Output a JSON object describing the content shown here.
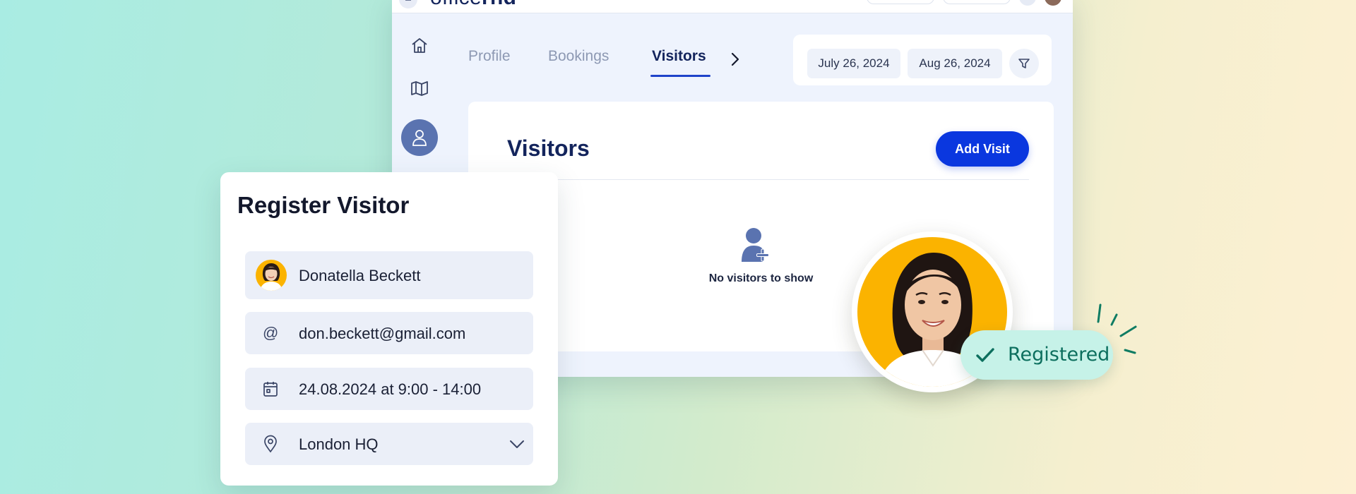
{
  "app": {
    "brand": {
      "prefix": "office",
      "suffix": "rnd"
    },
    "tabs": [
      {
        "label": "Profile",
        "active": false
      },
      {
        "label": "Bookings",
        "active": false
      },
      {
        "label": "Visitors",
        "active": true
      }
    ],
    "filters": {
      "start_date": "July 26, 2024",
      "end_date": "Aug 26, 2024"
    },
    "visitors": {
      "title": "Visitors",
      "add_button": "Add Visit",
      "empty_message": "No visitors to show"
    }
  },
  "register_form": {
    "title": "Register Visitor",
    "name": "Donatella Beckett",
    "email": "don.beckett@gmail.com",
    "email_symbol": "@",
    "datetime": "24.08.2024 at 9:00 - 14:00",
    "location": "London HQ"
  },
  "badge": {
    "label": "Registered"
  },
  "colors": {
    "brand_navy": "#13245c",
    "accent_blue": "#0a37df",
    "avatar_nav": "#5a73b0",
    "avatar_bg": "#fbb300",
    "success_bg": "#c6f2e8",
    "success_text": "#0c6f5e",
    "spark": "#0f7c63"
  },
  "icons": {
    "nav": [
      "home-icon",
      "map-icon",
      "user-icon"
    ],
    "form": [
      "at-icon",
      "calendar-icon",
      "location-pin-icon",
      "chevron-down-icon"
    ],
    "other": [
      "chevron-right-icon",
      "filter-icon",
      "add-user-icon",
      "checkmark-icon"
    ]
  }
}
